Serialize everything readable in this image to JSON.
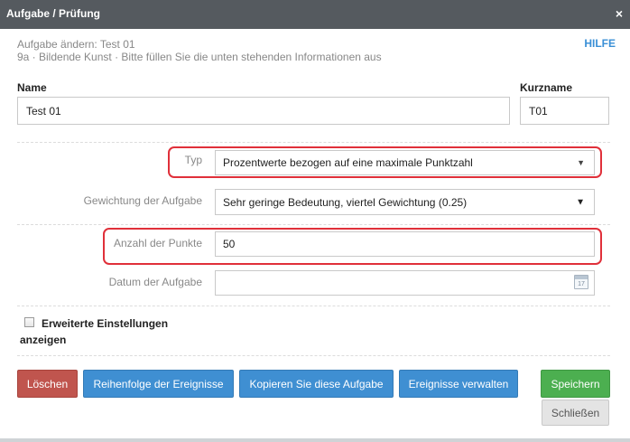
{
  "dialog": {
    "title": "Aufgabe / Prüfung",
    "close_glyph": "×",
    "subtitle_line1": "Aufgabe ändern: Test 01",
    "subtitle_line2": "9a · Bildende Kunst · Bitte füllen Sie die unten stehenden Informationen aus",
    "help_label": "HILFE"
  },
  "fields": {
    "name_label": "Name",
    "name_value": "Test 01",
    "short_label": "Kurzname",
    "short_value": "T01",
    "type_label": "Typ",
    "type_value": "Prozentwerte bezogen auf eine maximale Punktzahl",
    "weight_label": "Gewichtung der Aufgabe",
    "weight_value": "Sehr geringe Bedeutung, viertel Gewichtung (0.25)",
    "points_label": "Anzahl der Punkte",
    "points_value": "50",
    "date_label": "Datum der Aufgabe",
    "date_value": "",
    "calendar_day": "17"
  },
  "advanced": {
    "label": "Erweiterte Einstellungen anzeigen",
    "checked": false
  },
  "buttons": {
    "delete": "Löschen",
    "order": "Reihenfolge der Ereignisse",
    "copy": "Kopieren Sie diese Aufgabe",
    "manage": "Ereignisse verwalten",
    "save": "Speichern",
    "close": "Schließen"
  },
  "colors": {
    "titlebar": "#555a5f",
    "help": "#3a8fd6",
    "highlight": "#e0303a",
    "delete": "#c0554e",
    "primary": "#3f8fd2",
    "save": "#4caf50"
  },
  "icons": {
    "close": "close-icon",
    "select_caret": "caret-down-icon",
    "date": "calendar-icon"
  }
}
